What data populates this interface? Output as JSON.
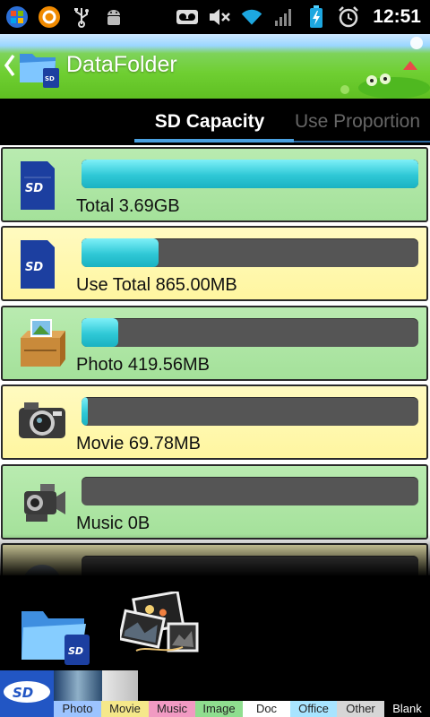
{
  "status_bar": {
    "time": "12:51",
    "icons": [
      "windows-icon",
      "orange-app-icon",
      "usb-icon",
      "android-debug-icon",
      "voicemail-icon",
      "mute-icon",
      "wifi-icon",
      "signal-icon",
      "battery-charging-icon",
      "alarm-icon"
    ]
  },
  "header": {
    "title": "DataFolder",
    "back_icon": "chevron-left-icon",
    "app_icon": "folder-sd-icon"
  },
  "tabs": [
    {
      "label": "SD Capacity",
      "active": true
    },
    {
      "label": "Use Proportion",
      "active": false
    }
  ],
  "rows": [
    {
      "label": "Total 3.69GB",
      "icon": "sd-card-icon",
      "fill": 1.0,
      "bg": "green"
    },
    {
      "label": "Use Total 865.00MB",
      "icon": "sd-card-icon",
      "fill": 0.23,
      "bg": "yellow"
    },
    {
      "label": "Photo 419.56MB",
      "icon": "photo-box-icon",
      "fill": 0.11,
      "bg": "green"
    },
    {
      "label": "Movie 69.78MB",
      "icon": "camera-icon",
      "fill": 0.018,
      "bg": "yellow"
    },
    {
      "label": "Music 0B",
      "icon": "camcorder-icon",
      "fill": 0.0,
      "bg": "green"
    },
    {
      "label": "",
      "icon": "disc-icon",
      "fill": 0.0,
      "bg": "yellow"
    }
  ],
  "dock": [
    "folder-sd-icon",
    "photo-collage-icon"
  ],
  "legend": [
    {
      "label": "Photo",
      "color": "#9cc4ff"
    },
    {
      "label": "Movie",
      "color": "#f5e88a"
    },
    {
      "label": "Music",
      "color": "#f19ac2"
    },
    {
      "label": "Image",
      "color": "#8fde8f"
    },
    {
      "label": "Doc",
      "color": "#ffffff"
    },
    {
      "label": "Office",
      "color": "#a8e4ff"
    },
    {
      "label": "Other",
      "color": "#d6d6d6"
    },
    {
      "label": "Blank",
      "color": "#000000"
    }
  ],
  "colors": {
    "accent_tab": "#4aa0e0",
    "bar_fill": "#2fc8d6",
    "bar_track": "#555555",
    "row_green": "#a4e19a",
    "row_yellow": "#fff6a0"
  }
}
